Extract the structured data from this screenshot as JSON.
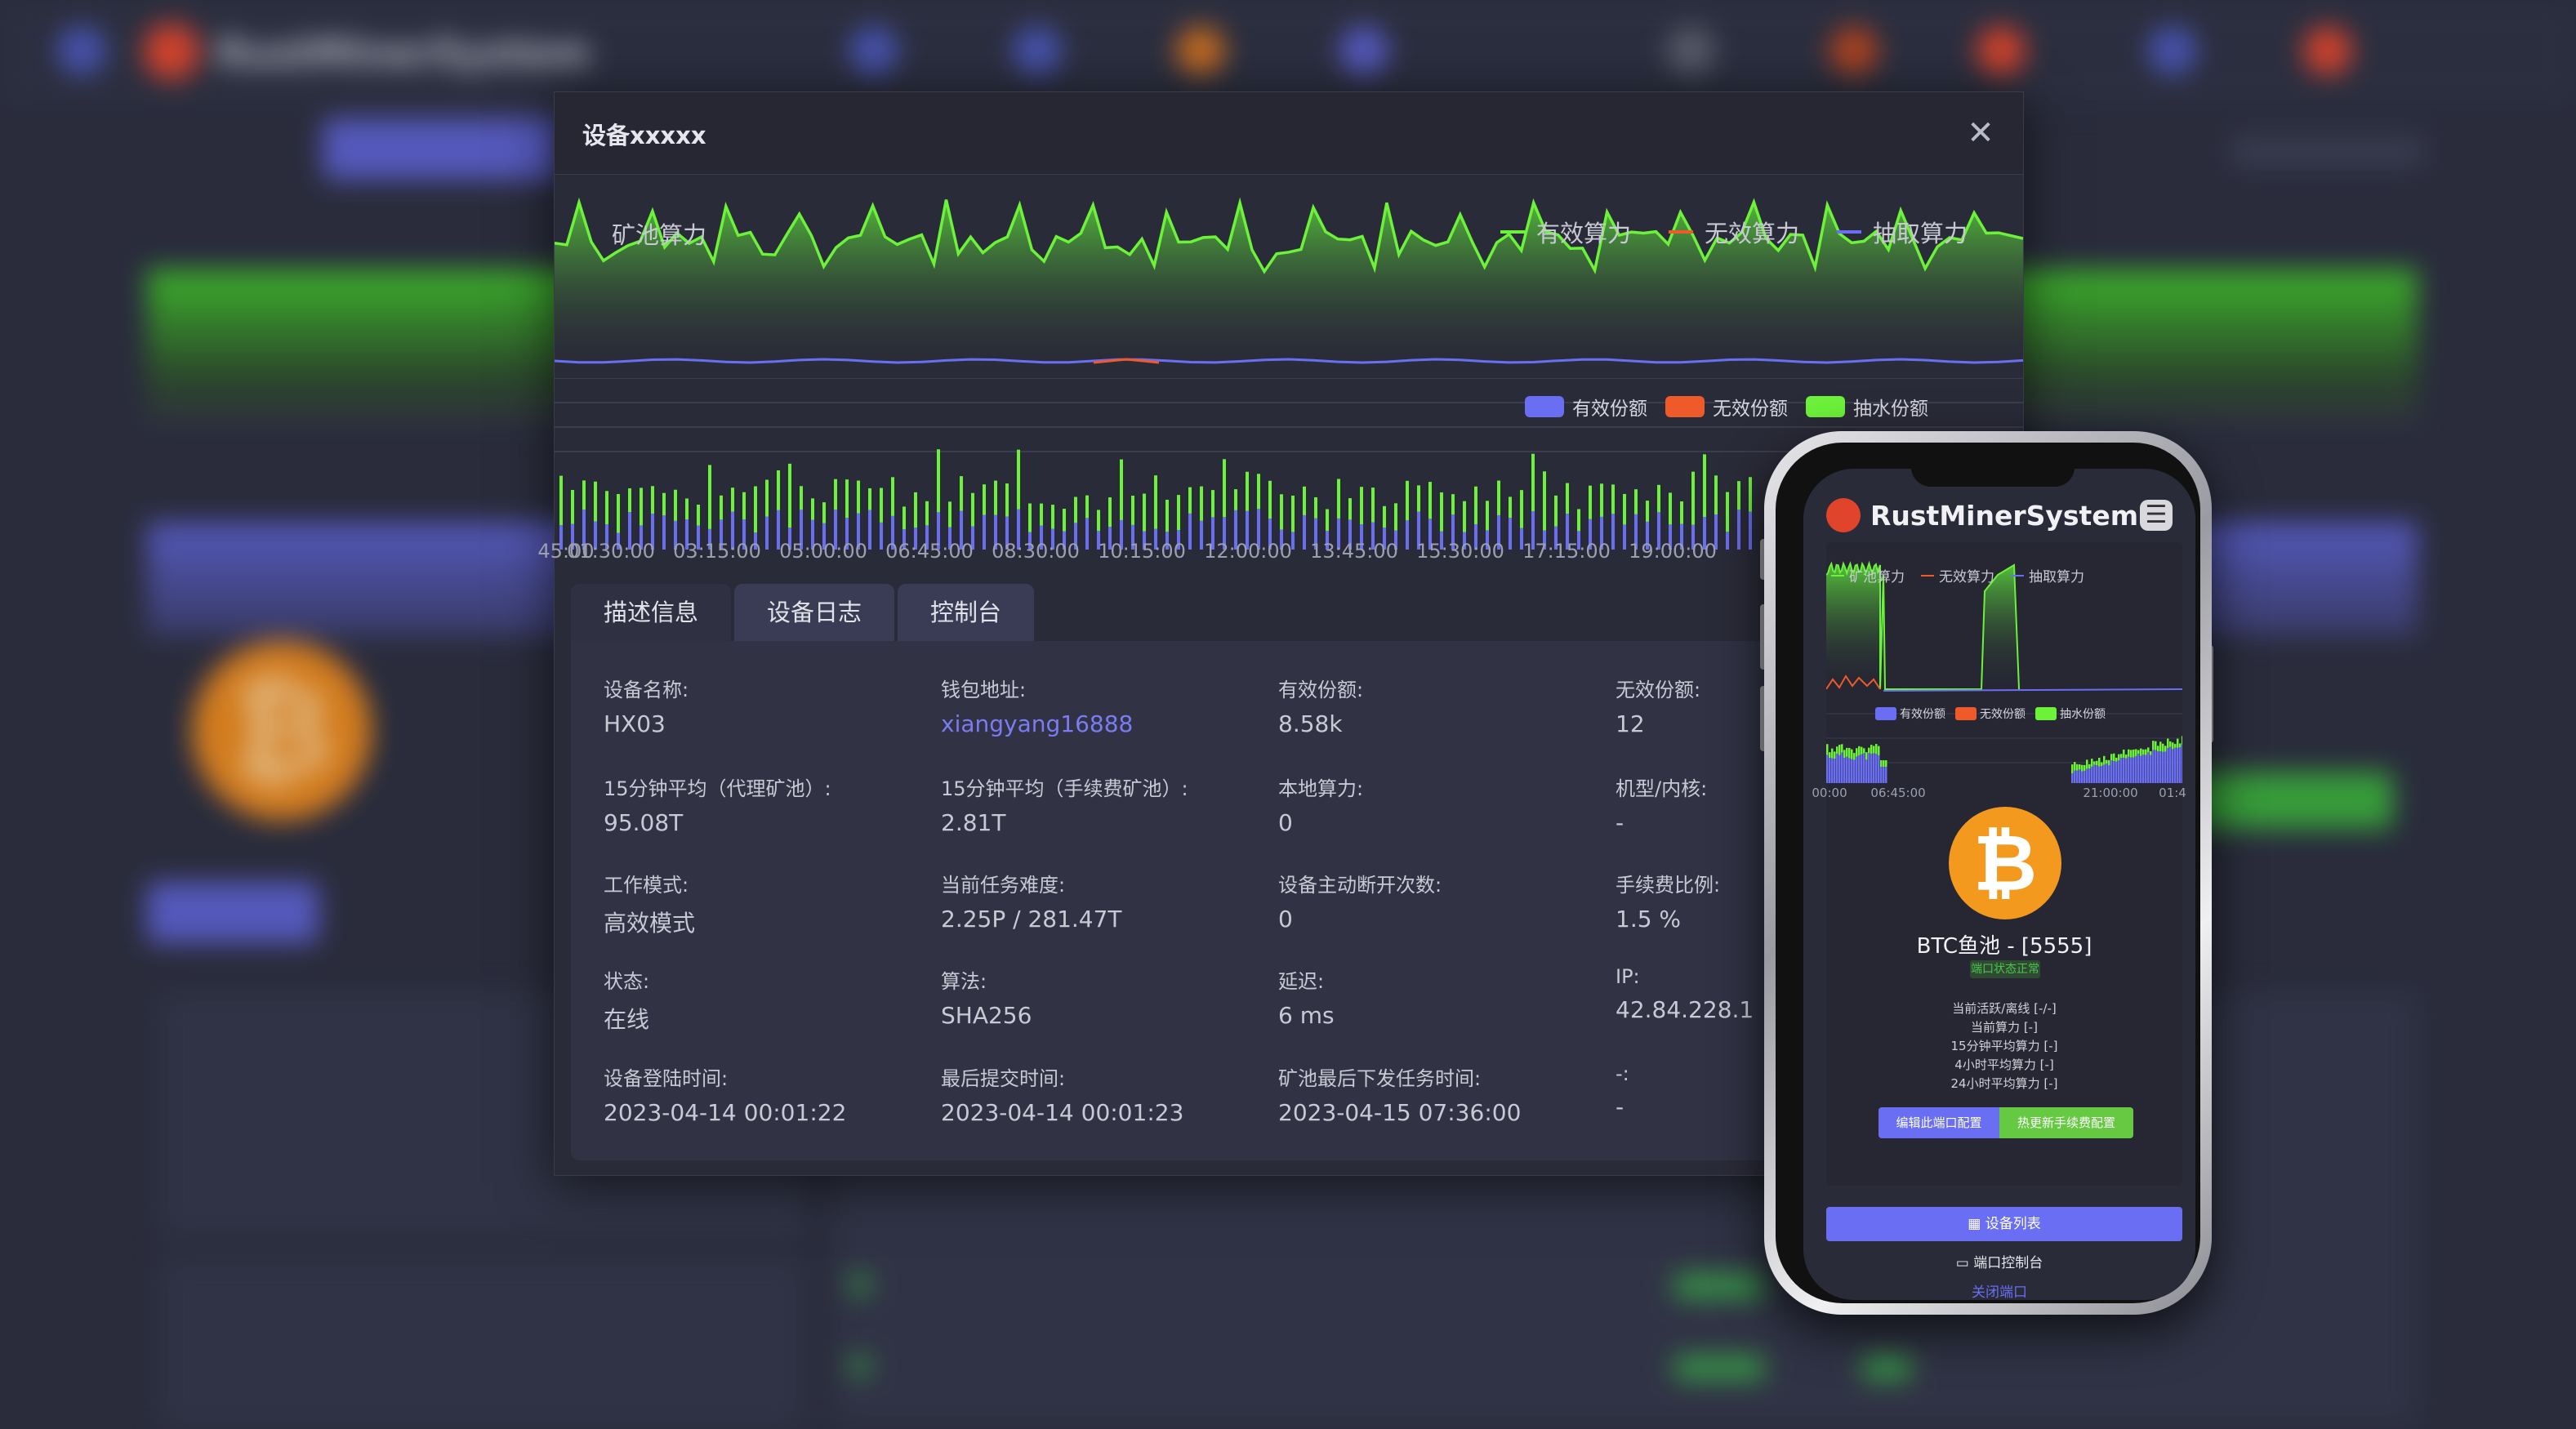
{
  "background": {
    "brand": "RustMinerSystem"
  },
  "dialog": {
    "title": "设备xxxxx",
    "close_icon": "close-icon",
    "hash_chart": {
      "title": "矿池算力",
      "legend": [
        "有效算力",
        "无效算力",
        "抽取算力"
      ]
    },
    "share_chart": {
      "legend": [
        "有效份额",
        "无效份额",
        "抽水份额"
      ]
    },
    "x_ticks": [
      "45:00",
      "01:30:00",
      "03:15:00",
      "05:00:00",
      "06:45:00",
      "08:30:00",
      "10:15:00",
      "12:00:00",
      "13:45:00",
      "15:30:00",
      "17:15:00",
      "19:00:00"
    ],
    "tabs": [
      "描述信息",
      "设备日志",
      "控制台"
    ],
    "fields": [
      {
        "label": "设备名称:",
        "value": "HX03"
      },
      {
        "label": "钱包地址:",
        "value": "xiangyang16888"
      },
      {
        "label": "有效份额:",
        "value": "8.58k"
      },
      {
        "label": "无效份额:",
        "value": "12"
      },
      {
        "label": "15分钟平均（代理矿池）:",
        "value": "95.08T"
      },
      {
        "label": "15分钟平均（手续费矿池）:",
        "value": "2.81T"
      },
      {
        "label": "本地算力:",
        "value": "0"
      },
      {
        "label": "机型/内核:",
        "value": "-"
      },
      {
        "label": "工作模式:",
        "value": "高效模式"
      },
      {
        "label": "当前任务难度:",
        "value": "2.25P / 281.47T"
      },
      {
        "label": "设备主动断开次数:",
        "value": "0"
      },
      {
        "label": "手续费比例:",
        "value": "1.5 %"
      },
      {
        "label": "状态:",
        "value": "在线"
      },
      {
        "label": "算法:",
        "value": "SHA256"
      },
      {
        "label": "延迟:",
        "value": "6 ms"
      },
      {
        "label": "IP:",
        "value": "42.84.228.1"
      },
      {
        "label": "设备登陆时间:",
        "value": "2023-04-14 00:01:22"
      },
      {
        "label": "最后提交时间:",
        "value": "2023-04-14 00:01:23"
      },
      {
        "label": "矿池最后下发任务时间:",
        "value": "2023-04-15 07:36:00"
      },
      {
        "label": "-:",
        "value": "-"
      }
    ]
  },
  "phone": {
    "brand": "RustMinerSystem",
    "hash_legend": [
      "矿池算力",
      "无效算力",
      "抽取算力"
    ],
    "share_legend": [
      "有效份额",
      "无效份额",
      "抽水份额"
    ],
    "x_ticks": [
      "00:00",
      "06:45:00",
      "21:00:00",
      "01:4"
    ],
    "coin_symbol": "₿",
    "pool_name": "BTC鱼池 - [5555]",
    "status_badge": "端口状态正常",
    "stats": [
      "当前活跃/离线 [-/-]",
      "当前算力 [-]",
      "15分钟平均算力 [-]",
      "4小时平均算力 [-]",
      "24小时平均算力 [-]"
    ],
    "edit_button": "编辑此端口配置",
    "fee_button": "热更新手续费配置",
    "device_list_button": "设备列表",
    "console_link": "端口控制台",
    "close_link": "关闭端口"
  },
  "colors": {
    "valid": "#6df23a",
    "invalid": "#ef5a2a",
    "fee": "#6a6ef2",
    "share_valid": "#6a6ef2",
    "share_invalid": "#ef5a2a",
    "share_fee": "#6df23a"
  }
}
